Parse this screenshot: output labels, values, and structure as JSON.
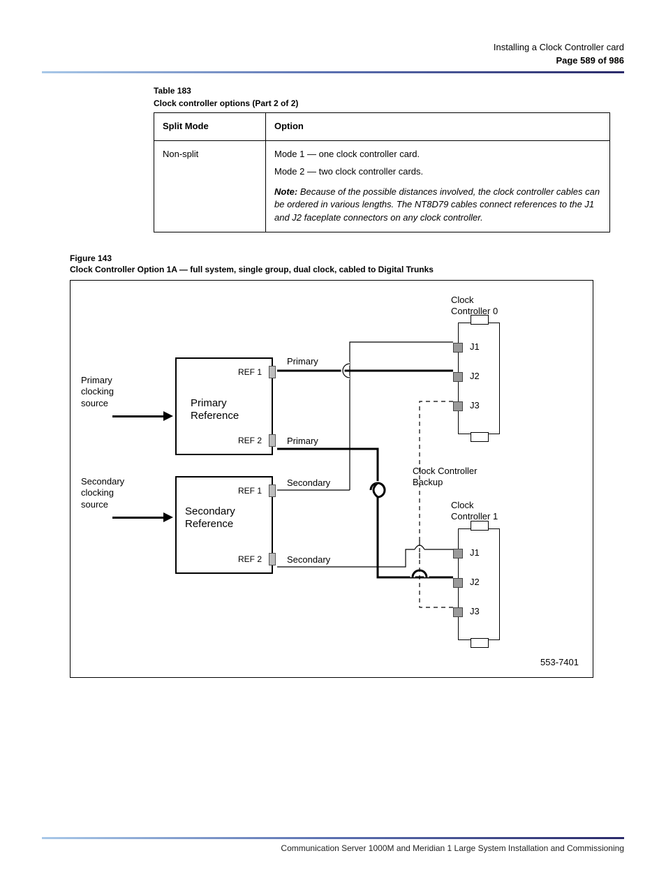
{
  "header": {
    "section": "Installing a Clock Controller card",
    "page_label": "Page 589 of 986"
  },
  "table": {
    "continued_label": "Table 183",
    "title": "Clock controller options (Part 2 of 2)",
    "col1_header": "Split Mode",
    "col2_header": "Option",
    "row_col1": "Non-split",
    "row_col2_lines": [
      "Mode 1 — one clock controller card.",
      "Mode 2 — two clock controller cards.",
      "",
      "Note: Because of the possible distances involved, the clock controller cables can be ordered in various lengths. The NT8D79 cables connect references to the J1 and J2 faceplate connectors on any clock controller."
    ]
  },
  "figure": {
    "caption": "Figure 143",
    "title": "Clock Controller Option 1A — full system, single group, dual clock, cabled to Digital Trunks",
    "labels": {
      "primary_src": "Primary\nclocking\nsource",
      "secondary_src": "Secondary\nclocking\nsource",
      "primary_ref": "Primary\nReference",
      "secondary_ref": "Secondary\nReference",
      "ref1": "REF 1",
      "ref2": "REF 2",
      "primary_line": "Primary",
      "secondary_line": "Secondary",
      "cc0": "Clock\nController 0",
      "cc1": "Clock\nController 1",
      "cc_backup": "Clock Controller\nBackup",
      "j1": "J1",
      "j2": "J2",
      "j3": "J3",
      "code": "553-7401"
    }
  },
  "footer": {
    "text": "Communication Server 1000M and Meridian 1    Large System Installation and Commissioning"
  }
}
